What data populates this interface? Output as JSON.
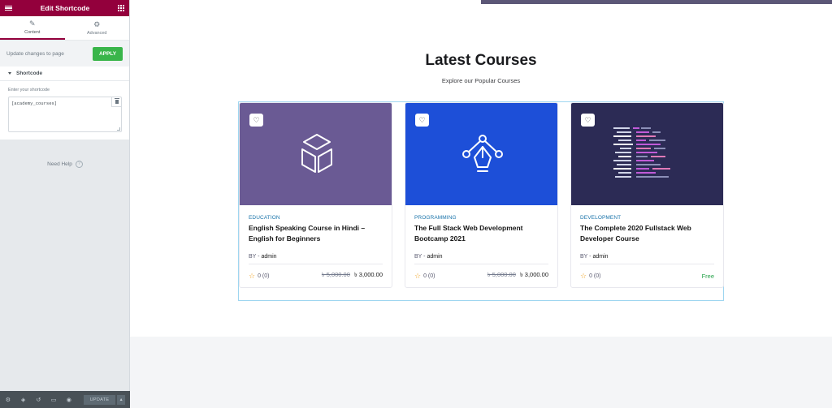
{
  "panel": {
    "title": "Edit Shortcode",
    "tabs": [
      {
        "label": "Content",
        "icon": "pencil-icon"
      },
      {
        "label": "Advanced",
        "icon": "gear-icon"
      }
    ],
    "apply_row": {
      "label": "Update changes to page",
      "button": "APPLY"
    },
    "section": {
      "title": "Shortcode",
      "field_label": "Enter your shortcode",
      "field_value": "[academy_courses]"
    },
    "help": {
      "label": "Need Help",
      "icon": "?"
    },
    "footer": {
      "update": "UPDATE",
      "more": "▴"
    }
  },
  "preview": {
    "heading": "Latest Courses",
    "subheading": "Explore our Popular Courses",
    "courses": [
      {
        "category": "EDUCATION",
        "title": "English Speaking Course in Hindi – English for Beginners",
        "by": "BY -",
        "author": "admin",
        "rating": "0 (0)",
        "old_price": "৳ 5,000.00",
        "price": "৳ 3,000.00",
        "thumb_color": "#6a5a94"
      },
      {
        "category": "PROGRAMMING",
        "title": "The Full Stack Web Development Bootcamp 2021",
        "by": "BY -",
        "author": "admin",
        "rating": "0 (0)",
        "old_price": "৳ 5,000.00",
        "price": "৳ 3,000.00",
        "thumb_color": "#1d4fd8"
      },
      {
        "category": "DEVELOPMENT",
        "title": "The Complete 2020 Fullstack Web Developer Course",
        "by": "BY -",
        "author": "admin",
        "rating": "0 (0)",
        "price_label": "Free",
        "thumb_color": "#2c2b55"
      }
    ]
  },
  "colors": {
    "header": "#93003c",
    "apply": "#39b54a",
    "category": "#1973aa",
    "free": "#24a148",
    "star": "#f1a527"
  }
}
